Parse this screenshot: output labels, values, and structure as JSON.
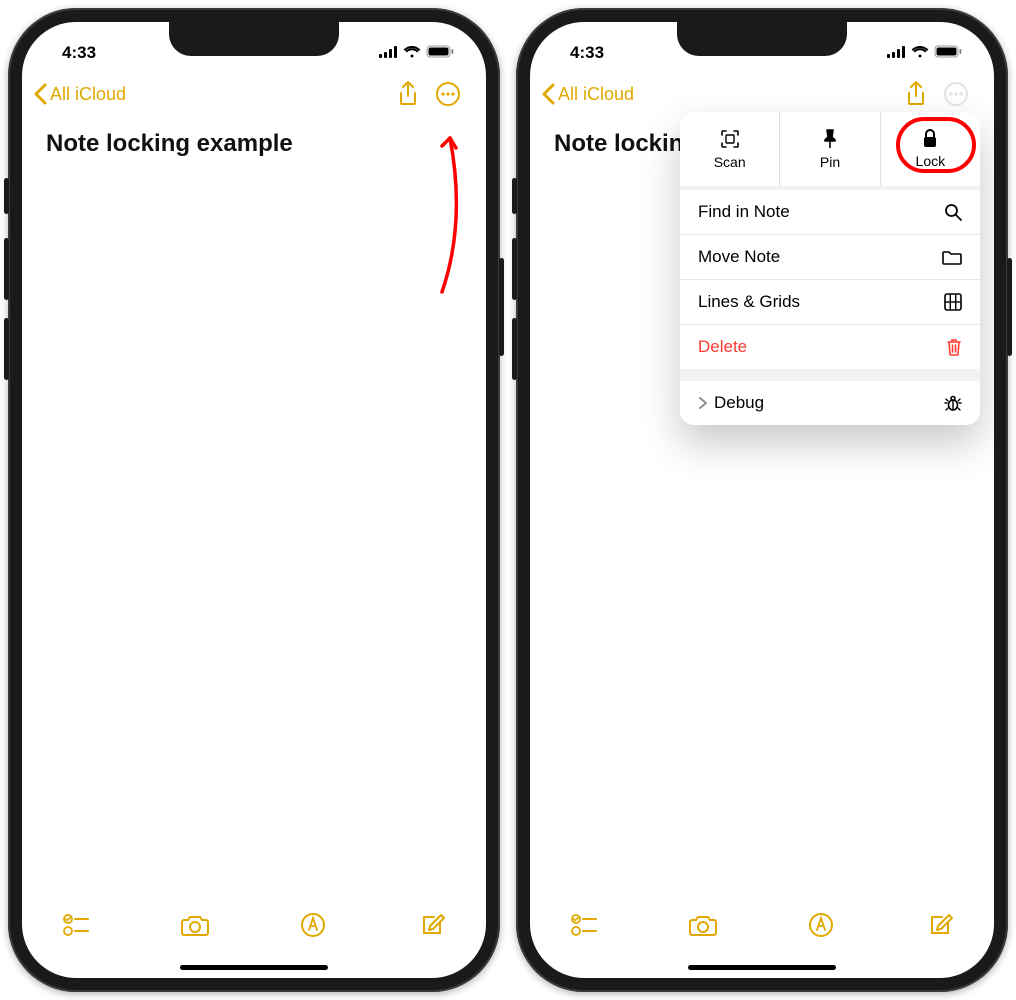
{
  "status": {
    "time": "4:33"
  },
  "nav": {
    "back_label": "All iCloud"
  },
  "note": {
    "title": "Note locking example"
  },
  "popover": {
    "top": {
      "scan": "Scan",
      "pin": "Pin",
      "lock": "Lock"
    },
    "items": {
      "find": "Find in Note",
      "move": "Move Note",
      "lines": "Lines & Grids",
      "delete": "Delete",
      "debug": "Debug"
    }
  },
  "colors": {
    "accent": "#e1a800",
    "destructive": "#ff3b30",
    "annotation": "#ff0000"
  }
}
